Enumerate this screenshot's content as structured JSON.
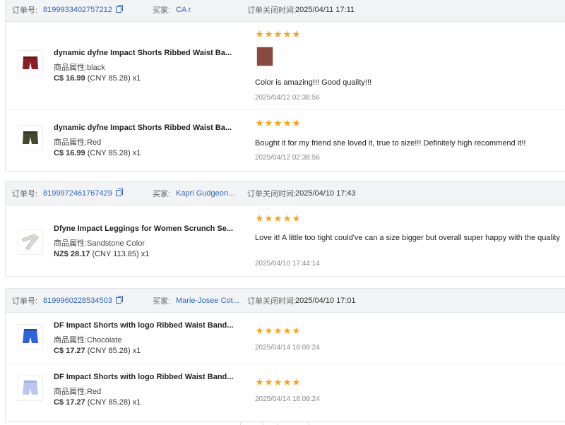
{
  "orders": [
    {
      "order_label": "订单号:",
      "order_no": "8199933402757212",
      "buyer_label": "买家:",
      "buyer": "CA r",
      "close_label": "订单关闭时间:",
      "close_time": "2025/04/11 17:11",
      "items": [
        {
          "title": "dynamic dyfne Impact Shorts Ribbed Waist Ba...",
          "attr_label": "商品属性:",
          "attr": "black",
          "price": "C$ 16.99",
          "cny": "(CNY  85.28)",
          "qty": "x1",
          "rating": 5,
          "review": "Color is amazing!!! Good quality!!!",
          "review_time": "2025/04/12 02:38:56",
          "has_photo": true
        },
        {
          "title": "dynamic dyfne Impact Shorts Ribbed Waist Ba...",
          "attr_label": "商品属性:",
          "attr": "Red",
          "price": "C$ 16.99",
          "cny": "(CNY  85.28)",
          "qty": "x1",
          "rating": 5,
          "review": "Bought it for my friend she loved it, true to size!!! Definitely high recommend it!!",
          "review_time": "2025/04/12 02:38:56",
          "has_photo": false
        }
      ]
    },
    {
      "order_label": "订单号:",
      "order_no": "8199972461767429",
      "buyer_label": "买家:",
      "buyer": "Kapri Gudgeon...",
      "close_label": "订单关闭时间:",
      "close_time": "2025/04/10 17:43",
      "items": [
        {
          "title": "Dfyne Impact Leggings for Women Scrunch Se...",
          "attr_label": "商品属性:",
          "attr": "Sandstone Color",
          "price": "NZ$ 28.17",
          "cny": "(CNY  113.85)",
          "qty": "x1",
          "rating": 5,
          "review": "Love it! A little too tight could've can a size bigger but overall super happy with the quality",
          "review_time": "2025/04/10 17:44:14",
          "has_photo": false
        }
      ]
    },
    {
      "order_label": "订单号:",
      "order_no": "8199960228534503",
      "buyer_label": "买家:",
      "buyer": "Marie-Josee Cot...",
      "close_label": "订单关闭时间:",
      "close_time": "2025/04/10 17:01",
      "items": [
        {
          "title": "DF Impact Shorts with logo Ribbed Waist Band...",
          "attr_label": "商品属性:",
          "attr": "Chocolate",
          "price": "C$ 17.27",
          "cny": "(CNY  85.28)",
          "qty": "x1",
          "rating": 5,
          "review": "",
          "review_time": "2025/04/14 18:09:24",
          "has_photo": false
        },
        {
          "title": "DF Impact Shorts with logo Ribbed Waist Band...",
          "attr_label": "商品属性:",
          "attr": "Red",
          "price": "C$ 17.27",
          "cny": "(CNY  85.28)",
          "qty": "x1",
          "rating": 5,
          "review": "",
          "review_time": "2025/04/14 18:09:24",
          "has_photo": false
        }
      ]
    }
  ],
  "colors": {
    "link": "#2f66c0",
    "star": "#f5a524",
    "header_bg": "#f2f3f5"
  }
}
